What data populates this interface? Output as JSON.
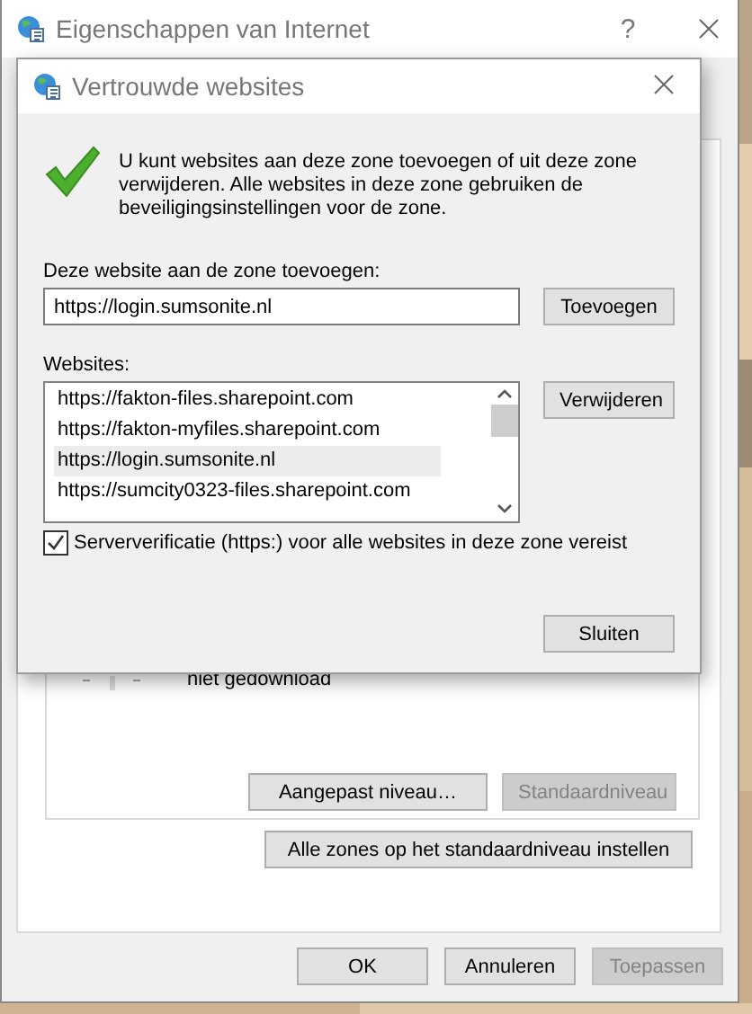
{
  "window": {
    "title": "Eigenschappen van Internet",
    "help_button": "?"
  },
  "zone_panel": {
    "partial_text": "niet gedownload",
    "buttons": [
      {
        "label": "Aangepast niveau…",
        "disabled": false
      },
      {
        "label": "Standaardniveau",
        "disabled": true
      }
    ],
    "reset_all_button": "Alle zones op het standaardniveau instellen"
  },
  "footer_buttons": [
    {
      "label": "OK",
      "disabled": false
    },
    {
      "label": "Annuleren",
      "disabled": false
    },
    {
      "label": "Toepassen",
      "disabled": true
    }
  ],
  "dialog": {
    "title": "Vertrouwde websites",
    "description": "U kunt websites aan deze zone toevoegen of uit deze zone verwijderen. Alle websites in deze zone gebruiken de beveiligingsinstellingen voor de zone.",
    "add_label": "Deze website aan de zone toevoegen:",
    "add_field": {
      "value": "https://login.sumsonite.nl"
    },
    "add_button": "Toevoegen",
    "list_label": "Websites:",
    "websites": [
      {
        "url": "https://fakton-files.sharepoint.com",
        "selected": false
      },
      {
        "url": "https://fakton-myfiles.sharepoint.com",
        "selected": false
      },
      {
        "url": "https://login.sumsonite.nl",
        "selected": true
      },
      {
        "url": "https://sumcity0323-files.sharepoint.com",
        "selected": false
      }
    ],
    "remove_button": "Verwijderen",
    "https_required": {
      "label": "Serververificatie (https:) voor alle websites in deze zone vereist",
      "checked": true
    },
    "close_button": "Sluiten"
  }
}
